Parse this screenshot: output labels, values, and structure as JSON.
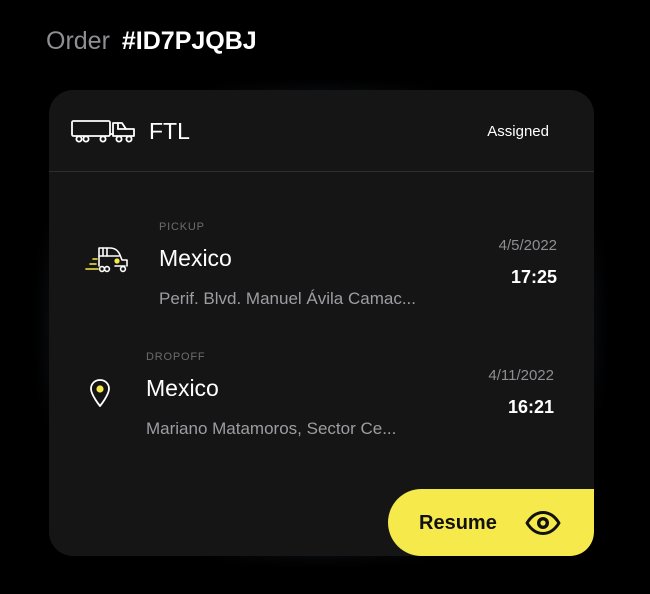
{
  "order": {
    "label": "Order",
    "id": "#ID7PJQBJ"
  },
  "card": {
    "freight_type": "FTL",
    "freight_icon": "truck-trailer-icon",
    "status": "Assigned",
    "pickup": {
      "kind": "PICKUP",
      "icon": "truck-cab-icon",
      "city": "Mexico",
      "address": "Perif. Blvd. Manuel Ávila Camac...",
      "date": "4/5/2022",
      "time": "17:25"
    },
    "dropoff": {
      "kind": "DROPOFF",
      "icon": "location-pin-icon",
      "city": "Mexico",
      "address": "Mariano Matamoros, Sector Ce...",
      "date": "4/11/2022",
      "time": "16:21"
    },
    "resume_button": {
      "label": "Resume",
      "icon": "eye-icon"
    }
  },
  "colors": {
    "background": "#000000",
    "card": "#151515",
    "accent": "#f6e94b",
    "text_primary": "#ffffff",
    "text_secondary": "#9d9da2",
    "text_muted": "#6c6c70"
  }
}
